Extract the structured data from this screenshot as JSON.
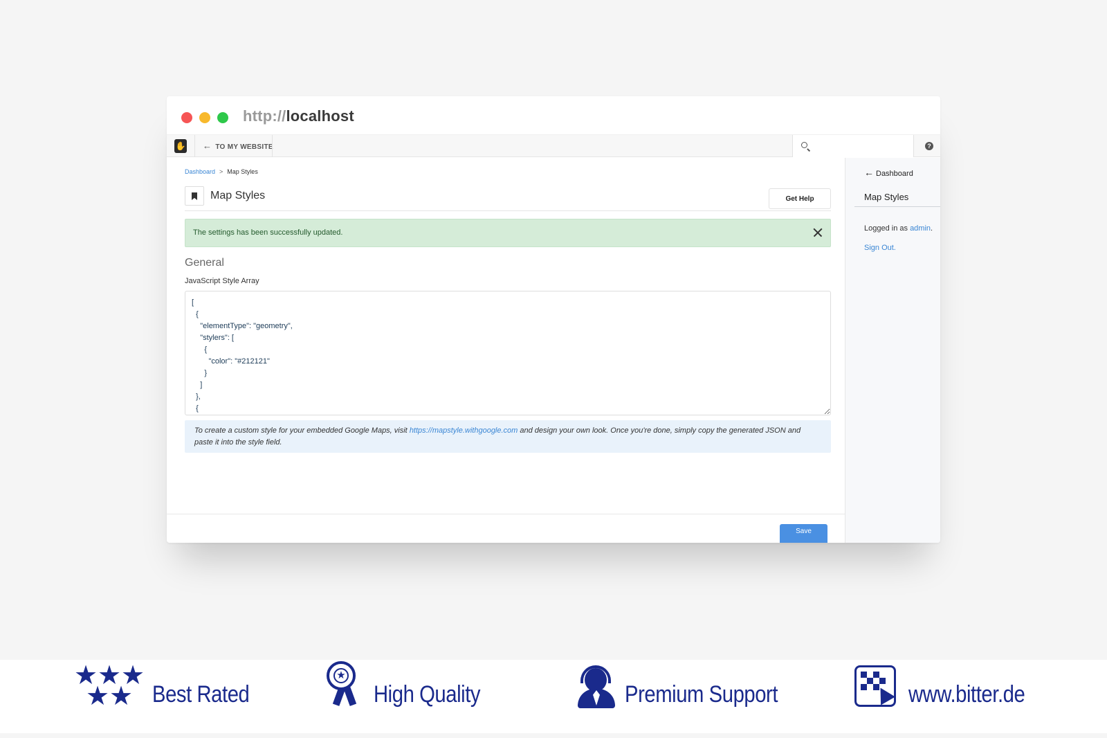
{
  "browser": {
    "url_protocol": "http://",
    "url_host": "localhost"
  },
  "toolbar": {
    "to_website_label": "TO MY WEBSITE",
    "search_placeholder": "",
    "help_glyph": "?"
  },
  "breadcrumb": {
    "items": [
      "Dashboard",
      "Map Styles"
    ],
    "separator": ">"
  },
  "page": {
    "title": "Map Styles",
    "get_help_label": "Get Help",
    "alert_message": "The settings has been successfully updated.",
    "section_title": "General",
    "field_label": "JavaScript Style Array",
    "field_value": "[\n  {\n    \"elementType\": \"geometry\",\n    \"stylers\": [\n      {\n        \"color\": \"#212121\"\n      }\n    ]\n  },\n  {",
    "info_prefix": "To create a custom style for your embedded Google Maps, visit ",
    "info_link": "https://mapstyle.withgoogle.com",
    "info_suffix": " and design your own look. Once you're done, simply copy the generated JSON and paste it into the style field.",
    "save_label": "Save"
  },
  "panel": {
    "back_label": "Dashboard",
    "title": "Map Styles",
    "logged_in_prefix": "Logged in as ",
    "logged_in_user": "admin",
    "logged_in_suffix": ".",
    "sign_out_label": "Sign Out."
  },
  "badges": {
    "best_rated": "Best Rated",
    "high_quality": "High Quality",
    "premium_support": "Premium Support",
    "website": "www.bitter.de"
  },
  "icons": {
    "back_arrow": "arrow-left-icon",
    "bookmark": "bookmark-icon",
    "close": "close-icon",
    "search": "search-icon",
    "help": "help-icon"
  },
  "colors": {
    "accent": "#4a90e2",
    "link": "#3a86d4",
    "success_bg": "#d5ecd8",
    "info_bg": "#e9f2fb",
    "badge_blue": "#1a2a8c"
  }
}
